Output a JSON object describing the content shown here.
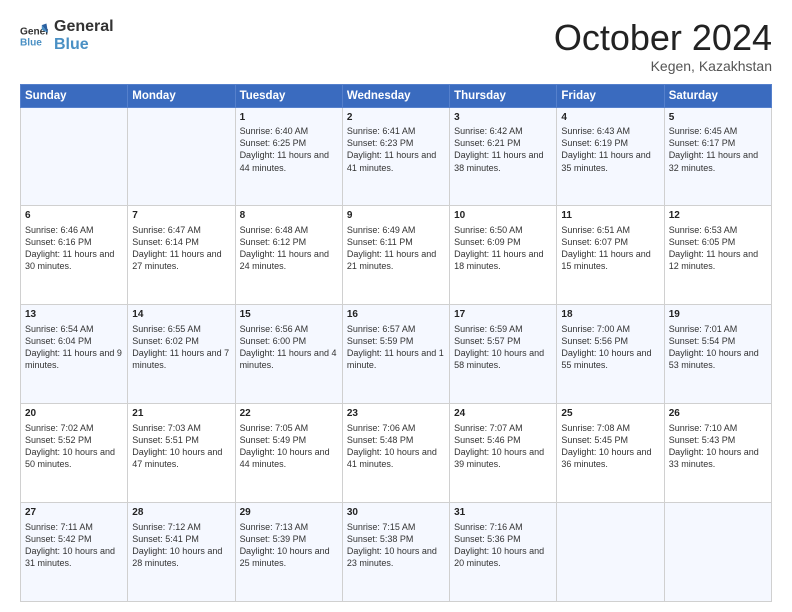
{
  "header": {
    "logo_line1": "General",
    "logo_line2": "Blue",
    "month": "October 2024",
    "location": "Kegen, Kazakhstan"
  },
  "days_of_week": [
    "Sunday",
    "Monday",
    "Tuesday",
    "Wednesday",
    "Thursday",
    "Friday",
    "Saturday"
  ],
  "weeks": [
    [
      {
        "day": "",
        "content": ""
      },
      {
        "day": "",
        "content": ""
      },
      {
        "day": "1",
        "content": "Sunrise: 6:40 AM\nSunset: 6:25 PM\nDaylight: 11 hours and 44 minutes."
      },
      {
        "day": "2",
        "content": "Sunrise: 6:41 AM\nSunset: 6:23 PM\nDaylight: 11 hours and 41 minutes."
      },
      {
        "day": "3",
        "content": "Sunrise: 6:42 AM\nSunset: 6:21 PM\nDaylight: 11 hours and 38 minutes."
      },
      {
        "day": "4",
        "content": "Sunrise: 6:43 AM\nSunset: 6:19 PM\nDaylight: 11 hours and 35 minutes."
      },
      {
        "day": "5",
        "content": "Sunrise: 6:45 AM\nSunset: 6:17 PM\nDaylight: 11 hours and 32 minutes."
      }
    ],
    [
      {
        "day": "6",
        "content": "Sunrise: 6:46 AM\nSunset: 6:16 PM\nDaylight: 11 hours and 30 minutes."
      },
      {
        "day": "7",
        "content": "Sunrise: 6:47 AM\nSunset: 6:14 PM\nDaylight: 11 hours and 27 minutes."
      },
      {
        "day": "8",
        "content": "Sunrise: 6:48 AM\nSunset: 6:12 PM\nDaylight: 11 hours and 24 minutes."
      },
      {
        "day": "9",
        "content": "Sunrise: 6:49 AM\nSunset: 6:11 PM\nDaylight: 11 hours and 21 minutes."
      },
      {
        "day": "10",
        "content": "Sunrise: 6:50 AM\nSunset: 6:09 PM\nDaylight: 11 hours and 18 minutes."
      },
      {
        "day": "11",
        "content": "Sunrise: 6:51 AM\nSunset: 6:07 PM\nDaylight: 11 hours and 15 minutes."
      },
      {
        "day": "12",
        "content": "Sunrise: 6:53 AM\nSunset: 6:05 PM\nDaylight: 11 hours and 12 minutes."
      }
    ],
    [
      {
        "day": "13",
        "content": "Sunrise: 6:54 AM\nSunset: 6:04 PM\nDaylight: 11 hours and 9 minutes."
      },
      {
        "day": "14",
        "content": "Sunrise: 6:55 AM\nSunset: 6:02 PM\nDaylight: 11 hours and 7 minutes."
      },
      {
        "day": "15",
        "content": "Sunrise: 6:56 AM\nSunset: 6:00 PM\nDaylight: 11 hours and 4 minutes."
      },
      {
        "day": "16",
        "content": "Sunrise: 6:57 AM\nSunset: 5:59 PM\nDaylight: 11 hours and 1 minute."
      },
      {
        "day": "17",
        "content": "Sunrise: 6:59 AM\nSunset: 5:57 PM\nDaylight: 10 hours and 58 minutes."
      },
      {
        "day": "18",
        "content": "Sunrise: 7:00 AM\nSunset: 5:56 PM\nDaylight: 10 hours and 55 minutes."
      },
      {
        "day": "19",
        "content": "Sunrise: 7:01 AM\nSunset: 5:54 PM\nDaylight: 10 hours and 53 minutes."
      }
    ],
    [
      {
        "day": "20",
        "content": "Sunrise: 7:02 AM\nSunset: 5:52 PM\nDaylight: 10 hours and 50 minutes."
      },
      {
        "day": "21",
        "content": "Sunrise: 7:03 AM\nSunset: 5:51 PM\nDaylight: 10 hours and 47 minutes."
      },
      {
        "day": "22",
        "content": "Sunrise: 7:05 AM\nSunset: 5:49 PM\nDaylight: 10 hours and 44 minutes."
      },
      {
        "day": "23",
        "content": "Sunrise: 7:06 AM\nSunset: 5:48 PM\nDaylight: 10 hours and 41 minutes."
      },
      {
        "day": "24",
        "content": "Sunrise: 7:07 AM\nSunset: 5:46 PM\nDaylight: 10 hours and 39 minutes."
      },
      {
        "day": "25",
        "content": "Sunrise: 7:08 AM\nSunset: 5:45 PM\nDaylight: 10 hours and 36 minutes."
      },
      {
        "day": "26",
        "content": "Sunrise: 7:10 AM\nSunset: 5:43 PM\nDaylight: 10 hours and 33 minutes."
      }
    ],
    [
      {
        "day": "27",
        "content": "Sunrise: 7:11 AM\nSunset: 5:42 PM\nDaylight: 10 hours and 31 minutes."
      },
      {
        "day": "28",
        "content": "Sunrise: 7:12 AM\nSunset: 5:41 PM\nDaylight: 10 hours and 28 minutes."
      },
      {
        "day": "29",
        "content": "Sunrise: 7:13 AM\nSunset: 5:39 PM\nDaylight: 10 hours and 25 minutes."
      },
      {
        "day": "30",
        "content": "Sunrise: 7:15 AM\nSunset: 5:38 PM\nDaylight: 10 hours and 23 minutes."
      },
      {
        "day": "31",
        "content": "Sunrise: 7:16 AM\nSunset: 5:36 PM\nDaylight: 10 hours and 20 minutes."
      },
      {
        "day": "",
        "content": ""
      },
      {
        "day": "",
        "content": ""
      }
    ]
  ]
}
